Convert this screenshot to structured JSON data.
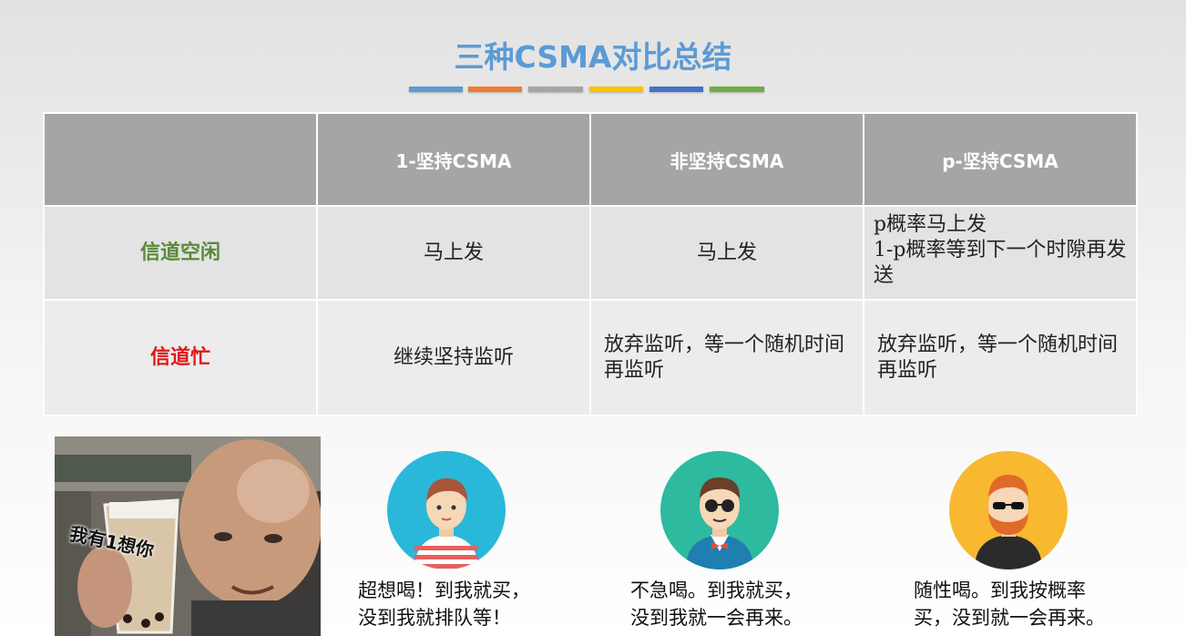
{
  "slide": {
    "title": "三种CSMA对比总结",
    "bar_colors": [
      "#5b9bd5",
      "#ed7d31",
      "#a5a5a5",
      "#ffc000",
      "#4472c4",
      "#70ad47"
    ]
  },
  "table": {
    "headers": [
      "",
      "1-坚持CSMA",
      "非坚持CSMA",
      "p-坚持CSMA"
    ],
    "rows": [
      {
        "label": "信道空闲",
        "label_color": "#5a8a3a",
        "cells": [
          "马上发",
          "马上发",
          "p概率马上发\n1-p概率等到下一个时隙再发送"
        ]
      },
      {
        "label": "信道忙",
        "label_color": "#e01818",
        "cells": [
          "继续坚持监听",
          "放弃监听，等一个随机时间再监听",
          "放弃监听，等一个随机时间再监听"
        ]
      }
    ]
  },
  "meme": {
    "caption_text": "我有1想你",
    "image": "man holding bubble tea cup"
  },
  "personas": [
    {
      "icon": "boy-striped-shirt-icon",
      "bg": "#29b8d9",
      "caption_line1": "超想喝！到我就买，",
      "caption_line2": "没到我就排队等！"
    },
    {
      "icon": "man-glasses-bowtie-icon",
      "bg": "#2dba9f",
      "caption_line1": "不急喝。到我就买，",
      "caption_line2": "没到我就一会再来。"
    },
    {
      "icon": "bearded-man-sunglasses-icon",
      "bg": "#f8b830",
      "caption_line1": "随性喝。到我按概率",
      "caption_line2": "买，没到就一会再来。"
    }
  ]
}
